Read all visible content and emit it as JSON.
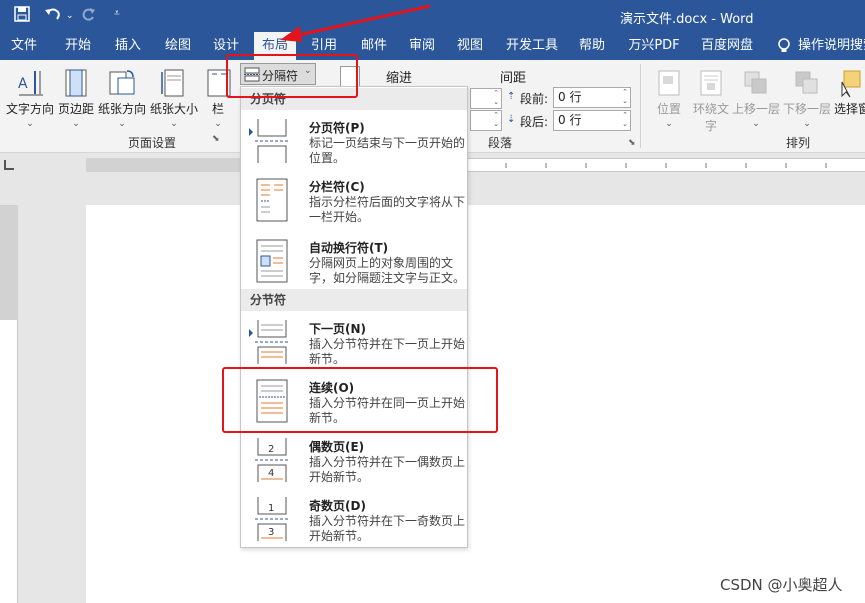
{
  "titlebar": {
    "title": "演示文件.docx - Word",
    "save_icon": "save-icon",
    "undo_icon": "undo-icon",
    "redo_icon": "redo-icon"
  },
  "tabs": [
    "文件",
    "开始",
    "插入",
    "绘图",
    "设计",
    "布局",
    "引用",
    "邮件",
    "审阅",
    "视图",
    "开发工具",
    "帮助",
    "万兴PDF",
    "百度网盘",
    "操作说明搜索"
  ],
  "active_tab": "布局",
  "ribbon": {
    "text_direction": "文字方向",
    "margins": "页边距",
    "orientation": "纸张方向",
    "size": "纸张大小",
    "columns": "栏",
    "breaks_button": "分隔符",
    "page_setup_group": "页面设置",
    "indent_label": "缩进",
    "spacing_label": "间距",
    "before_label": "段前:",
    "before_value": "0 行",
    "after_label": "段后:",
    "after_value": "0 行",
    "paragraph_group": "段落",
    "position": "位置",
    "wrap_text_1": "环绕文",
    "wrap_text_2": "字",
    "bring_forward": "上移一层",
    "send_backward": "下移一层",
    "selection_pane": "选择窗",
    "arrange_group": "排列"
  },
  "dropdown": {
    "page_breaks_header": "分页符",
    "section_breaks_header": "分节符",
    "items": [
      {
        "title": "分页符(P)",
        "desc": "标记一页结束与下一页开始的位置。"
      },
      {
        "title": "分栏符(C)",
        "desc": "指示分栏符后面的文字将从下一栏开始。"
      },
      {
        "title": "自动换行符(T)",
        "desc": "分隔网页上的对象周围的文字，如分隔题注文字与正文。"
      },
      {
        "title": "下一页(N)",
        "desc": "插入分节符并在下一页上开始新节。"
      },
      {
        "title": "连续(O)",
        "desc": "插入分节符并在同一页上开始新节。"
      },
      {
        "title": "偶数页(E)",
        "desc": "插入分节符并在下一偶数页上开始新节。"
      },
      {
        "title": "奇数页(D)",
        "desc": "插入分节符并在下一奇数页上开始新节。"
      }
    ]
  },
  "watermark": "CSDN @小奥超人",
  "colors": {
    "accent": "#2b579a",
    "annotation": "#e4141c"
  }
}
